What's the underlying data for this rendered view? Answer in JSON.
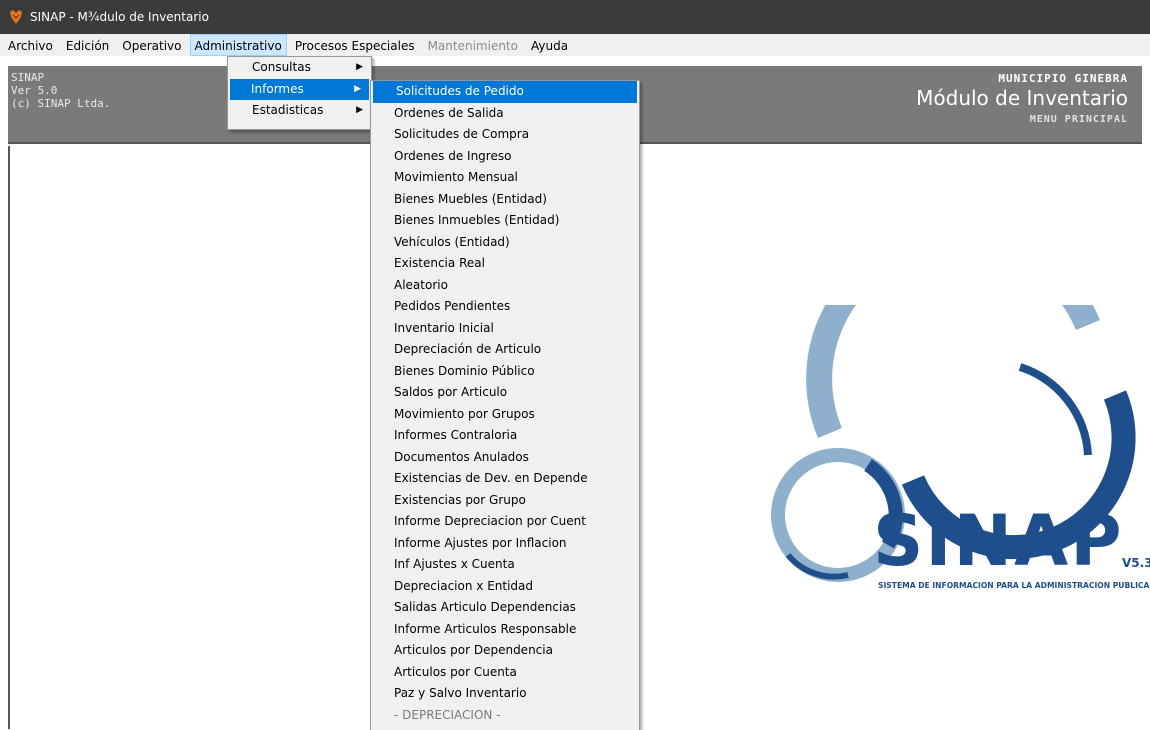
{
  "window": {
    "title": "SINAP - M¾dulo de Inventario",
    "icon": "sinap-app-icon"
  },
  "menubar": [
    {
      "label": "Archivo",
      "state": "normal"
    },
    {
      "label": "Edición",
      "state": "normal"
    },
    {
      "label": "Operativo",
      "state": "normal"
    },
    {
      "label": "Administrativo",
      "state": "active"
    },
    {
      "label": "Procesos Especiales",
      "state": "normal"
    },
    {
      "label": "Mantenimiento",
      "state": "disabled"
    },
    {
      "label": "Ayuda",
      "state": "normal"
    }
  ],
  "header": {
    "left": [
      "SINAP",
      "Ver 5.0",
      "(c) SINAP Ltda."
    ],
    "municipio": "MUNICIPIO GINEBRA",
    "modulo": "Módulo de Inventario",
    "menu_principal": "MENU PRINCIPAL"
  },
  "admin_menu": [
    {
      "label": "Consultas",
      "submenu": true
    },
    {
      "label": "Informes",
      "submenu": true,
      "highlighted": true
    },
    {
      "label": "Estadisticas",
      "submenu": true
    }
  ],
  "informes_menu": [
    "Solicitudes de Pedido",
    "Ordenes de Salida",
    "Solicitudes de Compra",
    "Ordenes de Ingreso",
    "Movimiento Mensual",
    "Bienes Muebles (Entidad)",
    "Bienes Inmuebles (Entidad)",
    "Vehículos (Entidad)",
    "Existencia Real",
    "Aleatorio",
    "Pedidos Pendientes",
    "Inventario Inicial",
    "Depreciación de Articulo",
    "Bienes Dominio Público",
    "Saldos por Articulo",
    "Movimiento por Grupos",
    "Informes Contraloria",
    "Documentos Anulados",
    "Existencias de Dev. en Depende",
    "Existencias por Grupo",
    "Informe Depreciacion por Cuent",
    "Informe Ajustes por Inflacion",
    "Inf Ajustes x Cuenta",
    "Depreciacion x Entidad",
    "Salidas Articulo Dependencias",
    "Informe Articulos Responsable",
    "Articulos por Dependencia",
    "Articulos por Cuenta",
    "Paz y Salvo Inventario",
    "- DEPRECIACION -"
  ],
  "informes_highlight_index": 0,
  "informes_disabled_index": 29,
  "logo": {
    "brand": "SINAP",
    "version": "V5.3",
    "tagline": "SISTEMA DE INFORMACION PARA LA ADMINISTRACION PUBLICA"
  },
  "colors": {
    "titlebar": "#3b3b3b",
    "menu_highlight": "#0078d7",
    "header_bg": "#7a7a7a",
    "logo_dark_blue": "#1e4f8c",
    "logo_light_blue": "#8fb0cc"
  }
}
